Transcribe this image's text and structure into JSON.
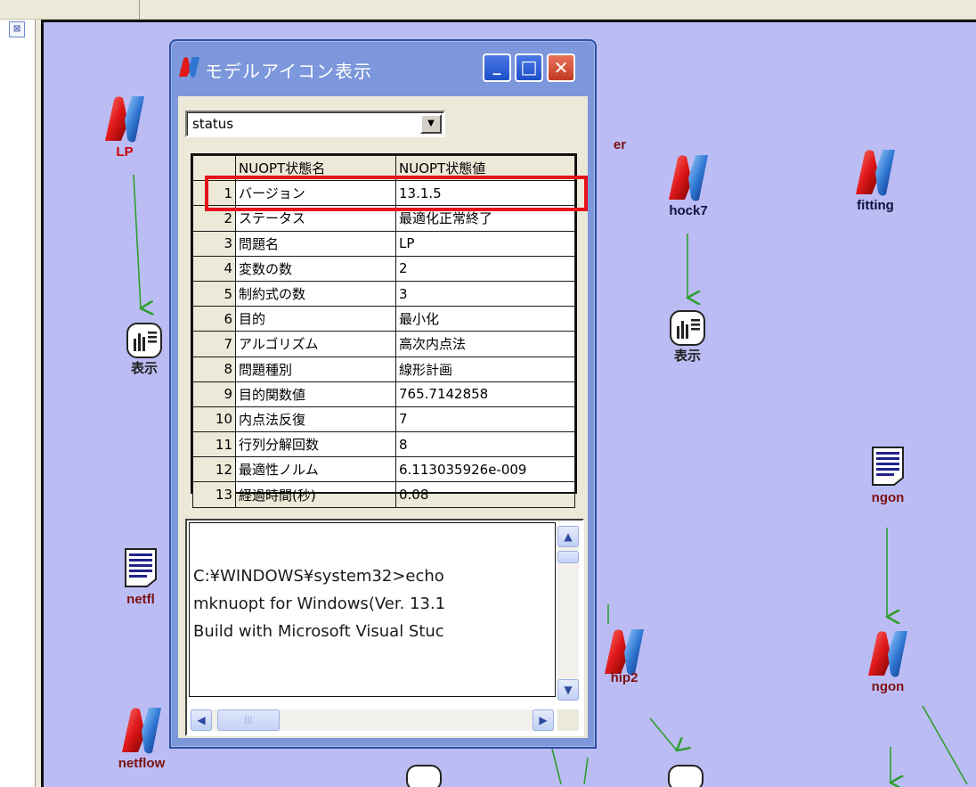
{
  "window": {
    "title": "モデルアイコン表示",
    "close_glyph": "✕",
    "maximize_glyph": "□",
    "minimize_glyph": "_"
  },
  "view_selector": {
    "value": "status"
  },
  "table": {
    "headers": [
      "NUOPT状態名",
      "NUOPT状態値"
    ],
    "rows": [
      {
        "index": "1",
        "name": "バージョン",
        "value": "13.1.5"
      },
      {
        "index": "2",
        "name": "ステータス",
        "value": "最適化正常終了"
      },
      {
        "index": "3",
        "name": "問題名",
        "value": "LP"
      },
      {
        "index": "4",
        "name": "変数の数",
        "value": "2"
      },
      {
        "index": "5",
        "name": "制約式の数",
        "value": "3"
      },
      {
        "index": "6",
        "name": "目的",
        "value": "最小化"
      },
      {
        "index": "7",
        "name": "アルゴリズム",
        "value": "高次内点法"
      },
      {
        "index": "8",
        "name": "問題種別",
        "value": "線形計画"
      },
      {
        "index": "9",
        "name": "目的関数値",
        "value": "765.7142858"
      },
      {
        "index": "10",
        "name": "内点法反復",
        "value": "7"
      },
      {
        "index": "11",
        "name": "行列分解回数",
        "value": "8"
      },
      {
        "index": "12",
        "name": "最適性ノルム",
        "value": "6.113035926e-009"
      },
      {
        "index": "13",
        "name": "経過時間(秒)",
        "value": "0.08"
      }
    ]
  },
  "console": {
    "lines": [
      "C:¥WINDOWS¥system32>echo",
      "mknuopt for Windows(Ver. 13.1",
      "Build with Microsoft Visual Stuc"
    ]
  },
  "canvas_nodes": {
    "lp": "LP",
    "er": "er",
    "hock7": "hock7",
    "fitting": "fitting",
    "display_1": "表示",
    "display_2": "表示",
    "ngon_doc": "ngon",
    "ngon_model": "ngon",
    "netflow_doc": "netfl",
    "netflow": "netflow",
    "hip2": "hip2"
  },
  "colors": {
    "canvas_bg": "#bcbcf4",
    "arrow": "#2e9e2e",
    "highlight": "#e8101a",
    "titlebar": "#7c97db"
  }
}
